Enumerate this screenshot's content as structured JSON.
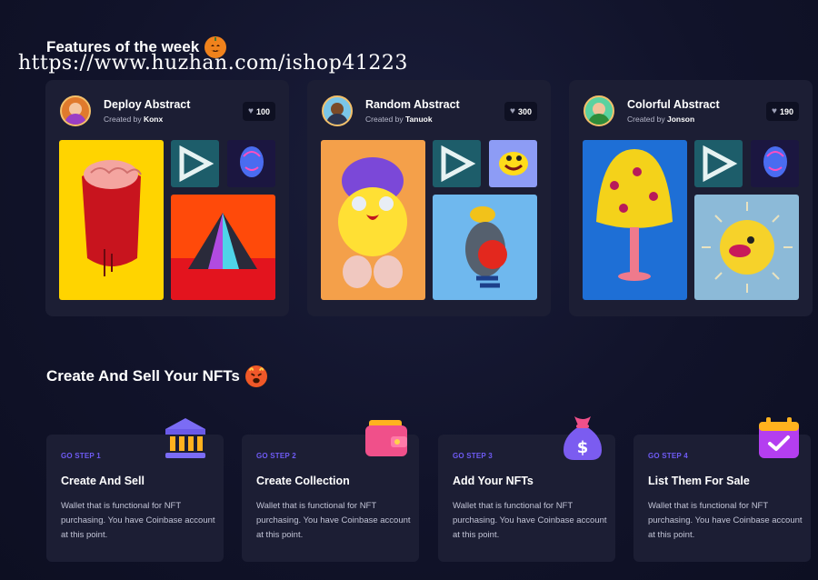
{
  "sections": {
    "features_title": "Features of the week",
    "create_title": "Create And Sell Your NFTs"
  },
  "watermark": "https://www.huzhan.com/ishop41223",
  "features": [
    {
      "title": "Deploy Abstract",
      "created_by_label": "Created by",
      "creator": "Konx",
      "likes": "100"
    },
    {
      "title": "Random Abstract",
      "created_by_label": "Created by",
      "creator": "Tanuok",
      "likes": "300"
    },
    {
      "title": "Colorful Abstract",
      "created_by_label": "Created by",
      "creator": "Jonson",
      "likes": "190"
    }
  ],
  "steps": [
    {
      "label": "GO STEP 1",
      "title": "Create And Sell",
      "description": "Wallet that is functional for NFT purchasing. You have Coinbase account at this point.",
      "icon": "bank-icon"
    },
    {
      "label": "GO STEP 2",
      "title": "Create Collection",
      "description": "Wallet that is functional for NFT purchasing. You have Coinbase account at this point.",
      "icon": "wallet-icon"
    },
    {
      "label": "GO STEP 3",
      "title": "Add Your NFTs",
      "description": "Wallet that is functional for NFT purchasing. You have Coinbase account at this point.",
      "icon": "money-bag-icon"
    },
    {
      "label": "GO STEP 4",
      "title": "List Them For Sale",
      "description": "Wallet that is functional for NFT purchasing. You have Coinbase account at this point.",
      "icon": "calendar-check-icon"
    }
  ],
  "colors": {
    "background": "#11132a",
    "card": "#1c1e34",
    "accent": "#6f5bf5"
  }
}
